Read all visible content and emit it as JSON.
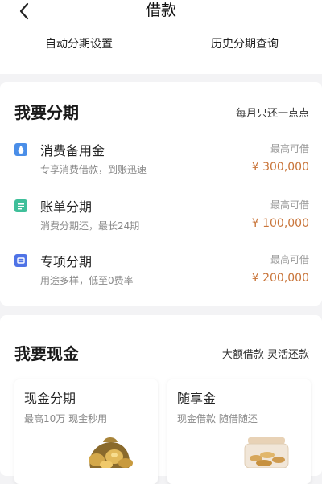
{
  "header": {
    "title": "借款"
  },
  "subnav": {
    "left": "自动分期设置",
    "right": "历史分期查询"
  },
  "installment": {
    "title": "我要分期",
    "subtitle": "每月只还一点点",
    "items": [
      {
        "name": "消费备用金",
        "desc": "专享消费借款，到账迅速",
        "limit_label": "最高可借",
        "amount": "¥ 300,000",
        "icon": "money-bag-icon",
        "color": "#4a8ee8"
      },
      {
        "name": "账单分期",
        "desc": "消费分期还，最长24期",
        "limit_label": "最高可借",
        "amount": "¥ 100,000",
        "icon": "bill-icon",
        "color": "#3fbf9a"
      },
      {
        "name": "专项分期",
        "desc": "用途多样，低至0费率",
        "limit_label": "最高可借",
        "amount": "¥ 200,000",
        "icon": "wallet-icon",
        "color": "#4f73e6"
      }
    ]
  },
  "cash": {
    "title": "我要现金",
    "subtitle": "大额借款 灵活还款",
    "cards": [
      {
        "name": "现金分期",
        "desc": "最高10万 现金秒用",
        "image": "gold-coins-image"
      },
      {
        "name": "随享金",
        "desc": "现金借款 随借随还",
        "image": "coin-jar-image"
      }
    ]
  }
}
